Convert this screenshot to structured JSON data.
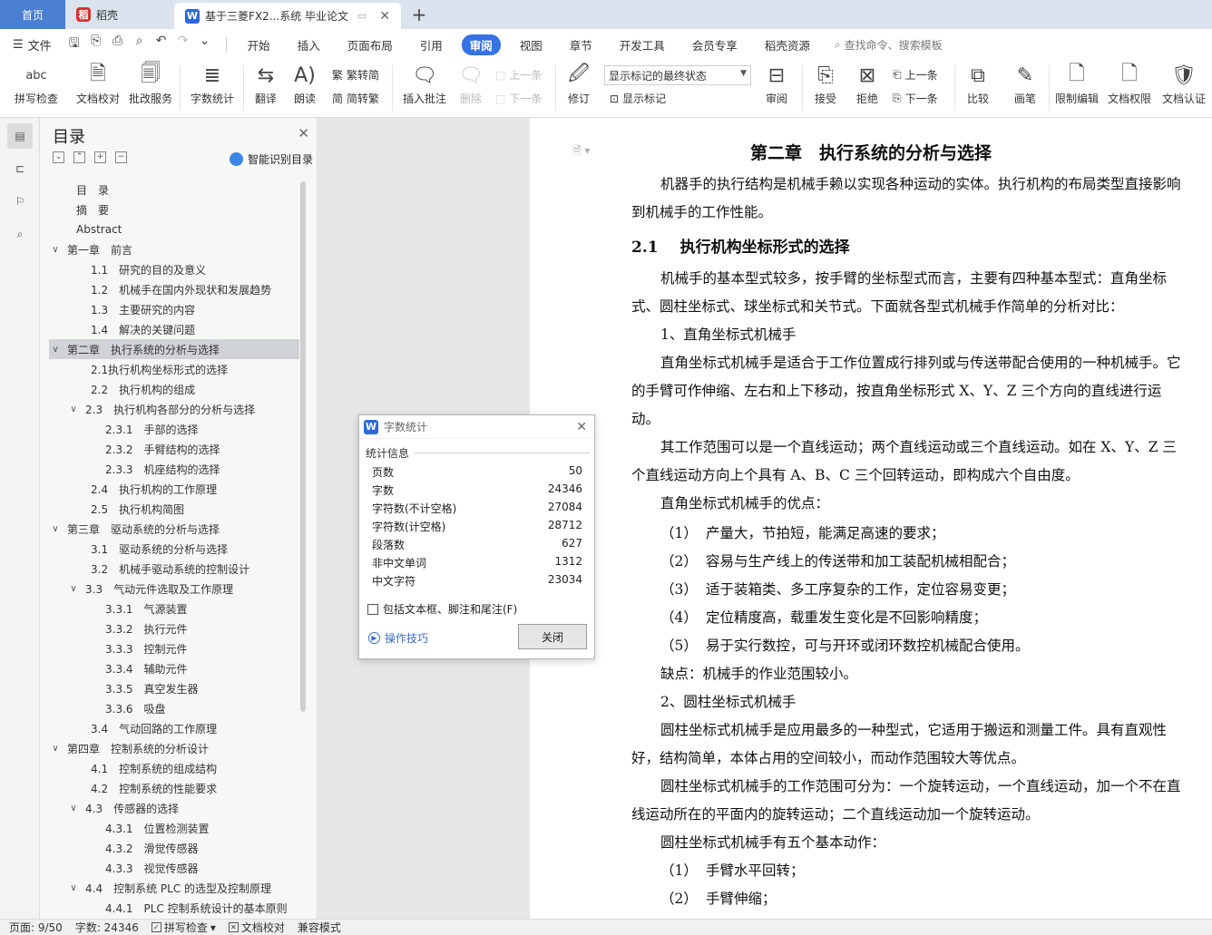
{
  "tabs": {
    "home": "首页",
    "daoke": "稻壳",
    "doc": "基于三菱FX2...系统 毕业论文"
  },
  "menubar": {
    "file": "文件",
    "items": [
      "开始",
      "插入",
      "页面布局",
      "引用",
      "审阅",
      "视图",
      "章节",
      "开发工具",
      "会员专享",
      "稻壳资源"
    ],
    "active": "审阅",
    "search": "查找命令、搜索模板"
  },
  "ribbon": {
    "spell": "拼写检查",
    "doc_check": "文档校对",
    "revise_service": "批改服务",
    "word_count": "字数统计",
    "translate": "翻译",
    "read": "朗读",
    "trad_simp": "繁转简",
    "simp_trad": "简转繁",
    "insert_comment": "插入批注",
    "delete": "删除",
    "prev_comment": "上一条",
    "next_comment": "下一条",
    "track": "修订",
    "display_combo": "显示标记的最终状态",
    "show_markup": "显示标记",
    "review": "审阅",
    "accept": "接受",
    "reject": "拒绝",
    "prev_change": "上一条",
    "next_change": "下一条",
    "compare": "比较",
    "ink": "画笔",
    "restrict": "限制编辑",
    "permission": "文档权限",
    "certify": "文档认证"
  },
  "toc": {
    "title": "目录",
    "smart": "智能识别目录",
    "items": [
      {
        "label": "目　录",
        "level": 1,
        "tw": ""
      },
      {
        "label": "摘　要",
        "level": 1,
        "tw": ""
      },
      {
        "label": "Abstract",
        "level": 1,
        "tw": ""
      },
      {
        "label": "第一章　前言",
        "level": 0,
        "tw": "v"
      },
      {
        "label": "1.1　研究的目的及意义",
        "level": 2,
        "tw": ""
      },
      {
        "label": "1.2　机械手在国内外现状和发展趋势",
        "level": 2,
        "tw": ""
      },
      {
        "label": "1.3　主要研究的内容",
        "level": 2,
        "tw": ""
      },
      {
        "label": "1.4　解决的关键问题",
        "level": 2,
        "tw": ""
      },
      {
        "label": "第二章　执行系统的分析与选择",
        "level": 0,
        "tw": "v",
        "selected": true
      },
      {
        "label": "2.1执行机构坐标形式的选择",
        "level": 2,
        "tw": ""
      },
      {
        "label": "2.2　执行机构的组成",
        "level": 2,
        "tw": ""
      },
      {
        "label": "2.3　执行机构各部分的分析与选择",
        "level": 1.5,
        "tw": "v"
      },
      {
        "label": "2.3.1　手部的选择",
        "level": 3,
        "tw": ""
      },
      {
        "label": "2.3.2　手臂结构的选择",
        "level": 3,
        "tw": ""
      },
      {
        "label": "2.3.3　机座结构的选择",
        "level": 3,
        "tw": ""
      },
      {
        "label": "2.4　执行机构的工作原理",
        "level": 2,
        "tw": ""
      },
      {
        "label": "2.5　执行机构简图",
        "level": 2,
        "tw": ""
      },
      {
        "label": "第三章　驱动系统的分析与选择",
        "level": 0,
        "tw": "v"
      },
      {
        "label": "3.1　驱动系统的分析与选择",
        "level": 2,
        "tw": ""
      },
      {
        "label": "3.2　机械手驱动系统的控制设计",
        "level": 2,
        "tw": ""
      },
      {
        "label": "3.3　气动元件选取及工作原理",
        "level": 1.5,
        "tw": "v"
      },
      {
        "label": "3.3.1　气源装置",
        "level": 3,
        "tw": ""
      },
      {
        "label": "3.3.2　执行元件",
        "level": 3,
        "tw": ""
      },
      {
        "label": "3.3.3　控制元件",
        "level": 3,
        "tw": ""
      },
      {
        "label": "3.3.4　辅助元件",
        "level": 3,
        "tw": ""
      },
      {
        "label": "3.3.5　真空发生器",
        "level": 3,
        "tw": ""
      },
      {
        "label": "3.3.6　吸盘",
        "level": 3,
        "tw": ""
      },
      {
        "label": "3.4　气动回路的工作原理",
        "level": 2,
        "tw": ""
      },
      {
        "label": "第四章　控制系统的分析设计",
        "level": 0,
        "tw": "v"
      },
      {
        "label": "4.1　控制系统的组成结构",
        "level": 2,
        "tw": ""
      },
      {
        "label": "4.2　控制系统的性能要求",
        "level": 2,
        "tw": ""
      },
      {
        "label": "4.3　传感器的选择",
        "level": 1.5,
        "tw": "v"
      },
      {
        "label": "4.3.1　位置检测装置",
        "level": 3,
        "tw": ""
      },
      {
        "label": "4.3.2　滑觉传感器",
        "level": 3,
        "tw": ""
      },
      {
        "label": "4.3.3　视觉传感器",
        "level": 3,
        "tw": ""
      },
      {
        "label": "4.4　控制系统 PLC 的选型及控制原理",
        "level": 1.5,
        "tw": "v"
      },
      {
        "label": "4.4.1　PLC 控制系统设计的基本原则",
        "level": 3,
        "tw": ""
      }
    ]
  },
  "document": {
    "chapter_title": "第二章　执行系统的分析与选择",
    "p1": "机器手的执行结构是机械手赖以实现各种运动的实体。执行机构的布局类型直接影响到机械手的工作性能。",
    "sec_num": "2.1",
    "sec_title": "执行机构坐标形式的选择",
    "p2": "机械手的基本型式较多，按手臂的坐标型式而言，主要有四种基本型式：直角坐标式、圆柱坐标式、球坐标式和关节式。下面就各型式机械手作简单的分析对比：",
    "p3": "1、直角坐标式机械手",
    "p4": "直角坐标式机械手是适合于工作位置成行排列或与传送带配合使用的一种机械手。它的手臂可作伸缩、左右和上下移动，按直角坐标形式 X、Y、Z 三个方向的直线进行运动。",
    "p5": "其工作范围可以是一个直线运动；两个直线运动或三个直线运动。如在 X、Y、Z 三个直线运动方向上个具有 A、B、C 三个回转运动，即构成六个自由度。",
    "p6": "直角坐标式机械手的优点：",
    "list1": [
      {
        "n": "（1）",
        "t": "产量大，节拍短，能满足高速的要求；"
      },
      {
        "n": "（2）",
        "t": "容易与生产线上的传送带和加工装配机械相配合；"
      },
      {
        "n": "（3）",
        "t": "适于装箱类、多工序复杂的工作，定位容易变更；"
      },
      {
        "n": "（4）",
        "t": "定位精度高，载重发生变化是不回影响精度；"
      },
      {
        "n": "（5）",
        "t": "易于实行数控，可与开环或闭环数控机械配合使用。"
      }
    ],
    "p7": "缺点：机械手的作业范围较小。",
    "p8": "2、圆柱坐标式机械手",
    "p9": "圆柱坐标式机械手是应用最多的一种型式，它适用于搬运和测量工件。具有直观性好，结构简单，本体占用的空间较小，而动作范围较大等优点。",
    "p10": "圆柱坐标式机械手的工作范围可分为：一个旋转运动，一个直线运动，加一个不在直线运动所在的平面内的旋转运动；二个直线运动加一个旋转运动。",
    "p11": "圆柱坐标式机械手有五个基本动作：",
    "list2": [
      {
        "n": "（1）",
        "t": "手臂水平回转；"
      },
      {
        "n": "（2）",
        "t": "手臂伸缩；"
      }
    ]
  },
  "dialog": {
    "title": "字数统计",
    "section": "统计信息",
    "rows": [
      {
        "label": "页数",
        "value": "50"
      },
      {
        "label": "字数",
        "value": "24346"
      },
      {
        "label": "字符数(不计空格)",
        "value": "27084"
      },
      {
        "label": "字符数(计空格)",
        "value": "28712"
      },
      {
        "label": "段落数",
        "value": "627"
      },
      {
        "label": "非中文单词",
        "value": "1312"
      },
      {
        "label": "中文字符",
        "value": "23034"
      }
    ],
    "checkbox": "包括文本框、脚注和尾注(F)",
    "tip": "操作技巧",
    "close": "关闭"
  },
  "status": {
    "page": "页面: 9/50",
    "words": "字数: 24346",
    "spell": "拼写检查",
    "doc_check": "文档校对",
    "compat": "兼容模式"
  }
}
